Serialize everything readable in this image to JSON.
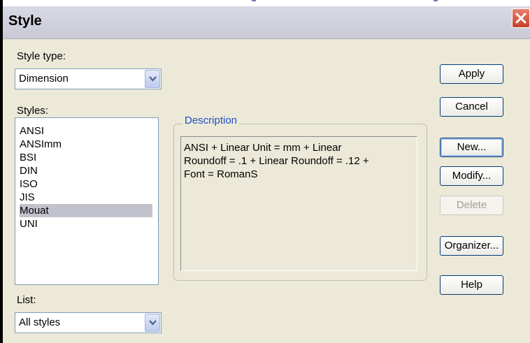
{
  "window": {
    "title": "Style"
  },
  "style_type": {
    "label": "Style type:",
    "selected": "Dimension"
  },
  "styles": {
    "label": "Styles:",
    "items": [
      "ANSI",
      "ANSImm",
      "BSI",
      "DIN",
      "ISO",
      "JIS",
      "Mouat",
      "UNI"
    ],
    "selected": "Mouat"
  },
  "description": {
    "title": "Description",
    "lines": [
      "ANSI + Linear Unit = mm + Linear",
      "Roundoff = .1 + Linear Roundoff = .12 +",
      "Font = RomanS"
    ]
  },
  "list": {
    "label": "List:",
    "selected": "All styles"
  },
  "buttons": {
    "apply": "Apply",
    "cancel": "Cancel",
    "new": "New...",
    "modify": "Modify...",
    "delete": "Delete",
    "organizer": "Organizer...",
    "help": "Help"
  },
  "icons": {
    "close": "close-icon",
    "dropdown": "chevron-down-icon"
  },
  "colors": {
    "accent_title": "#1e50c8",
    "selection": "#c1c2cc",
    "close_button": "#c6402b"
  }
}
